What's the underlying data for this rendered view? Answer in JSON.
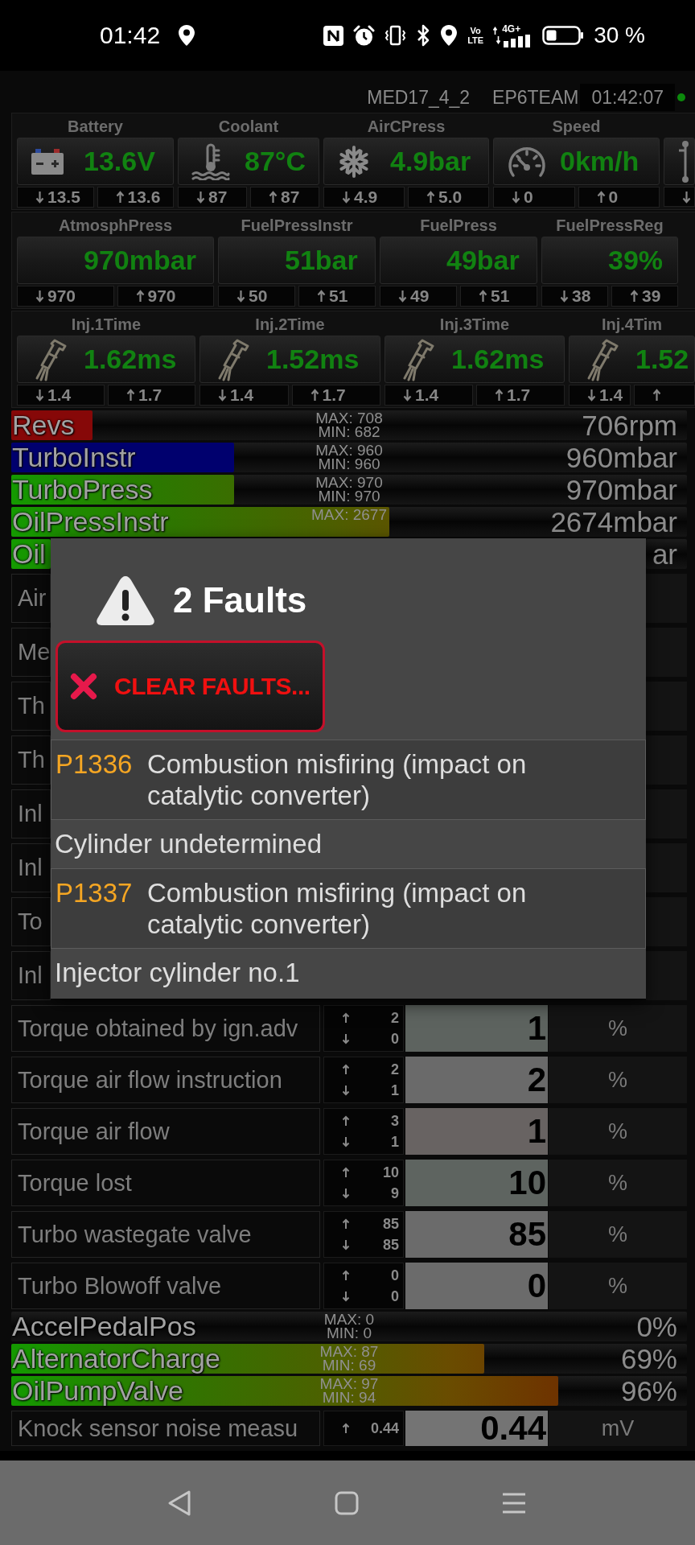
{
  "status_bar": {
    "time": "01:42",
    "volte_top": "Vo",
    "volte_bottom": "LTE",
    "network": "4G+",
    "battery": "30 %"
  },
  "header": {
    "ecu": "MED17_4_2",
    "team": "EP6TEAM",
    "clock": "01:42:07",
    "connected": true
  },
  "gauge_rows": [
    [
      {
        "label": "Battery",
        "kind": "battery",
        "value": "13.6V",
        "min": "13.5",
        "max": "13.6"
      },
      {
        "label": "Coolant",
        "kind": "coolant",
        "value": "87°C",
        "min": "87",
        "max": "87"
      },
      {
        "label": "AirCPress",
        "kind": "snowflake",
        "value": "4.9bar",
        "min": "4.9",
        "max": "5.0"
      },
      {
        "label": "Speed",
        "kind": "speedometer",
        "value": "0km/h",
        "min": "0",
        "max": "0"
      },
      {
        "kind": "lever"
      }
    ],
    [
      {
        "label": "AtmosphPress",
        "kind": "plain",
        "value": "970mbar",
        "min": "970",
        "max": "970"
      },
      {
        "label": "FuelPressInstr",
        "kind": "plain",
        "value": "51bar",
        "min": "50",
        "max": "51"
      },
      {
        "label": "FuelPress",
        "kind": "plain",
        "value": "49bar",
        "min": "49",
        "max": "51"
      },
      {
        "label": "FuelPressReg",
        "kind": "plain",
        "value": "39%",
        "min": "38",
        "max": "39"
      }
    ],
    [
      {
        "label": "Inj.1Time",
        "kind": "injector",
        "value": "1.62ms",
        "min": "1.4",
        "max": "1.7"
      },
      {
        "label": "Inj.2Time",
        "kind": "injector",
        "value": "1.52ms",
        "min": "1.4",
        "max": "1.7"
      },
      {
        "label": "Inj.3Time",
        "kind": "injector",
        "value": "1.62ms",
        "min": "1.4",
        "max": "1.7"
      },
      {
        "label": "Inj.4Tim",
        "kind": "injector",
        "value": "1.52",
        "min": "1.4"
      }
    ]
  ],
  "monitor": [
    {
      "kind": "bar",
      "covered": false,
      "label": "Revs",
      "color": "#860808",
      "level": 0.12,
      "max": "MAX: 708",
      "min": "MIN: 682",
      "value": "706rpm"
    },
    {
      "kind": "bar",
      "covered": false,
      "label": "TurboInstr",
      "color": "#00006e",
      "level": 0.33,
      "max": "MAX: 960",
      "min": "MIN: 960",
      "value": "960mbar"
    },
    {
      "kind": "bar",
      "covered": false,
      "label": "TurboPress",
      "level": 0.33,
      "max": "MAX: 970",
      "min": "MIN: 970",
      "value": "970mbar"
    },
    {
      "kind": "bar",
      "covered": false,
      "label": "OilPressInstr",
      "level": 0.56,
      "max": "MAX: 2677",
      "value": "2674mbar"
    },
    {
      "kind": "bar",
      "covered": true,
      "label": "Oil",
      "value": "ar"
    },
    {
      "kind": "row",
      "covered": true,
      "label": "Air"
    },
    {
      "kind": "row",
      "covered": true,
      "label": "Me"
    },
    {
      "kind": "row",
      "covered": true,
      "label": "Th"
    },
    {
      "kind": "row",
      "covered": true,
      "label": "Th"
    },
    {
      "kind": "row",
      "covered": true,
      "label": "Inl"
    },
    {
      "kind": "row",
      "covered": true,
      "label": "Inl"
    },
    {
      "kind": "row",
      "covered": true,
      "label": "To"
    },
    {
      "kind": "row",
      "covered": true,
      "label": "Inl"
    },
    {
      "kind": "row",
      "covered": false,
      "label": "Torque obtained by ign.adv",
      "max": "2",
      "min": "0",
      "value": "1",
      "unit": "%",
      "color": "#5d635f"
    },
    {
      "kind": "row",
      "covered": false,
      "label": "Torque air flow instruction",
      "max": "2",
      "min": "1",
      "value": "2",
      "unit": "%",
      "color": "#6a6a6a"
    },
    {
      "kind": "row",
      "covered": false,
      "label": "Torque air flow",
      "max": "3",
      "min": "1",
      "value": "1",
      "unit": "%",
      "color": "#686362"
    },
    {
      "kind": "row",
      "covered": false,
      "label": "Torque lost",
      "max": "10",
      "min": "9",
      "value": "10",
      "unit": "%",
      "color": "#5e6460"
    },
    {
      "kind": "row",
      "covered": false,
      "label": "Turbo wastegate valve",
      "max": "85",
      "min": "85",
      "value": "85",
      "unit": "%",
      "color": "#6b6b6b"
    },
    {
      "kind": "row",
      "covered": false,
      "label": "Turbo Blowoff valve",
      "max": "0",
      "min": "0",
      "value": "0",
      "unit": "%",
      "color": "#6b6b6b"
    },
    {
      "kind": "bar",
      "covered": false,
      "label": "AccelPedalPos",
      "max": "MAX: 0",
      "min": "MIN: 0",
      "value": "0%"
    },
    {
      "kind": "bar",
      "covered": false,
      "label": "AlternatorCharge",
      "level": 0.7,
      "max": "MAX: 87",
      "min": "MIN: 69",
      "value": "69%"
    },
    {
      "kind": "bar",
      "covered": false,
      "label": "OilPumpValve",
      "level": 0.81,
      "max": "MAX: 97",
      "min": "MIN: 94",
      "value": "96%"
    },
    {
      "kind": "row",
      "covered": false,
      "label": "Knock sensor noise measu",
      "max": "0.44",
      "value": "0.44",
      "unit": "mV",
      "color": "#747474"
    }
  ],
  "dialog": {
    "title": "2 Faults",
    "clear_button": "CLEAR FAULTS...",
    "faults": [
      {
        "code": "P1336",
        "description": "Combustion misfiring (impact on catalytic converter)",
        "detail": "Cylinder undetermined"
      },
      {
        "code": "P1337",
        "description": "Combustion misfiring (impact on catalytic converter)",
        "detail": "Injector cylinder no.1"
      }
    ]
  }
}
